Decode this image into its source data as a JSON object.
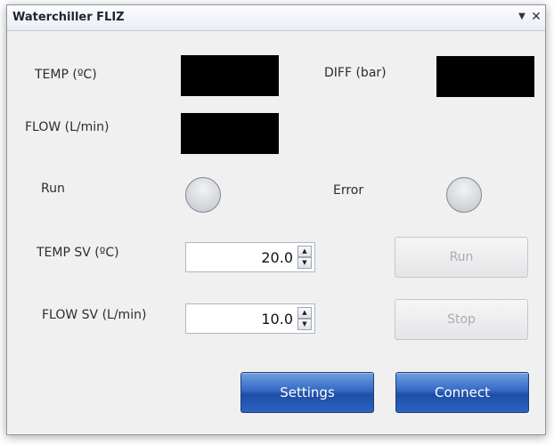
{
  "window": {
    "title": "Waterchiller FLIZ",
    "menu_glyph": "▼",
    "close_glyph": "✕"
  },
  "readings": {
    "temp_label": "TEMP (ºC)",
    "diff_label": "DIFF (bar)",
    "flow_label": "FLOW (L/min)",
    "temp_value": "",
    "diff_value": "",
    "flow_value": "",
    "display_color": "#000000"
  },
  "indicators": {
    "run_label": "Run",
    "error_label": "Error",
    "led_state": "off"
  },
  "setpoints": {
    "temp_sv_label": "TEMP SV (ºC)",
    "temp_sv_value": "20.0",
    "flow_sv_label": "FLOW SV (L/min)",
    "flow_sv_value": "10.0",
    "up_glyph": "▲",
    "down_glyph": "▼"
  },
  "actions": {
    "run_label": "Run",
    "stop_label": "Stop",
    "settings_label": "Settings",
    "connect_label": "Connect",
    "primary_color": "#2c5fbf",
    "disabled_text_color": "#a9adb3"
  }
}
